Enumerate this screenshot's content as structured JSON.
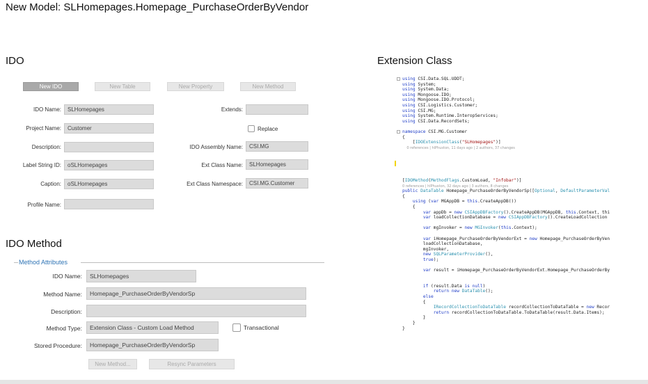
{
  "page_title": "New Model: SLHomepages.Homepage_PurchaseOrderByVendor",
  "ido": {
    "title": "IDO",
    "buttons": [
      "New IDO",
      "New Table",
      "New Property",
      "New Method"
    ],
    "fields": {
      "ido_name": {
        "label": "IDO Name:",
        "value": "SLHomepages"
      },
      "project_name": {
        "label": "Project Name:",
        "value": "Customer"
      },
      "description": {
        "label": "Description:",
        "value": ""
      },
      "label_string_id": {
        "label": "Label String ID:",
        "value": "oSLHomepages"
      },
      "caption": {
        "label": "Caption:",
        "value": "oSLHomepages"
      },
      "profile_name": {
        "label": "Profile Name:",
        "value": ""
      },
      "extends": {
        "label": "Extends:",
        "value": ""
      },
      "replace": {
        "label": "Replace"
      },
      "assembly_name": {
        "label": "IDO Assembly Name:",
        "value": "CSI.MG"
      },
      "ext_class_name": {
        "label": "Ext Class Name:",
        "value": "SLHomepages"
      },
      "ext_class_namespace": {
        "label": "Ext Class Namespace:",
        "value": "CSI.MG.Customer"
      }
    }
  },
  "ido_method": {
    "title": "IDO Method",
    "group_label": "Method Attributes",
    "fields": {
      "ido_name": {
        "label": "IDO Name:",
        "value": "SLHomepages"
      },
      "method_name": {
        "label": "Method Name:",
        "value": "Homepage_PurchaseOrderByVendorSp"
      },
      "description": {
        "label": "Description:",
        "value": ""
      },
      "method_type": {
        "label": "Method Type:",
        "value": "Extension Class - Custom Load Method"
      },
      "transactional": {
        "label": "Transactional"
      },
      "stored_procedure": {
        "label": "Stored Procedure:",
        "value": "Homepage_PurchaseOrderByVendorSp"
      }
    },
    "buttons": [
      "New Method...",
      "Resync Parameters"
    ]
  },
  "extension_class": {
    "title": "Extension Class",
    "code_top": [
      "using CSI.Data.SQL.UDDT;",
      "using System;",
      "using System.Data;",
      "using Mongoose.IDO;",
      "using Mongoose.IDO.Protocol;",
      "using CSI.Logistics.Customer;",
      "using CSI.MG;",
      "using System.Runtime.InteropServices;",
      "using CSI.Data.RecordSets;",
      "",
      "namespace CSI.MG.Customer",
      "{",
      "    [IDOExtensionClass(\"SLHomepages\")]",
      "    0 references | hlPhuston, 11 days ago | 2 authors, 37 changes"
    ],
    "code_bottom": [
      "[IDOMethod(MethodFlags.CustomLoad, \"Infobar\")]",
      "0 references | hlPhuston, 32 days ago | 3 authors, 8 changes",
      "public DataTable Homepage_PurchaseOrderByVendorSp([Optional, DefaultParameterVal",
      "{",
      "    using (var MGAppDB = this.CreateAppDB())",
      "    {",
      "        var appDb = new CSIAppDBFactory().CreateAppDB(MGAppDB, this.Context, thi",
      "        var loadCollectionDatabase = new CSIAppDBFactory().CreateLoadCollection",
      "",
      "        var mgInvoker = new MGInvoker(this.Context);",
      "",
      "        var iHomepage_PurchaseOrderByVendorExt = new Homepage_PurchaseOrderByVen",
      "        loadCollectionDatabase,",
      "        mgInvoker,",
      "        new SQLParameterProvider(),",
      "        true);",
      "",
      "        var result = iHomepage_PurchaseOrderByVendorExt.Homepage_PurchaseOrderBy",
      "",
      "",
      "        if (result.Data is null)",
      "            return new DataTable();",
      "        else",
      "        {",
      "            IRecordCollectionToDataTable recordCollectionToDataTable = new Recor",
      "            return recordCollectionToDataTable.ToDataTable(result.Data.Items);",
      "        }",
      "    }",
      "}"
    ]
  }
}
